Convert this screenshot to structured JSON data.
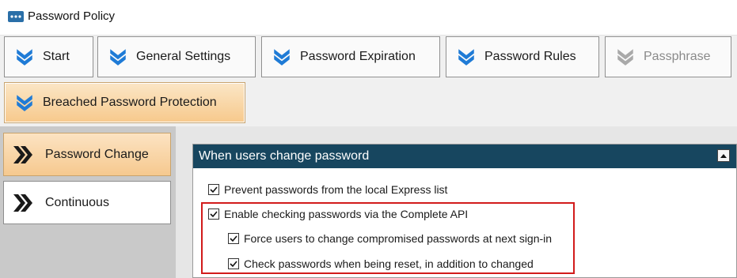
{
  "window": {
    "title": "Password Policy",
    "icon": "app-window-icon"
  },
  "toolbar": {
    "buttons": [
      {
        "label": "Start",
        "state": "normal"
      },
      {
        "label": "General Settings",
        "state": "normal"
      },
      {
        "label": "Password Expiration",
        "state": "normal"
      },
      {
        "label": "Password Rules",
        "state": "normal"
      },
      {
        "label": "Passphrase",
        "state": "disabled"
      },
      {
        "label": "Breached Password Protection",
        "state": "active"
      }
    ]
  },
  "sidebar": {
    "items": [
      {
        "label": "Password Change",
        "active": true
      },
      {
        "label": "Continuous",
        "active": false
      }
    ]
  },
  "group": {
    "title": "When users change password",
    "options": [
      {
        "label": "Prevent passwords from the local Express list",
        "checked": true
      },
      {
        "label": "Enable checking passwords via the Complete API",
        "checked": true
      },
      {
        "label": "Force users to change compromised passwords at next sign-in",
        "checked": true
      },
      {
        "label": "Check passwords when being reset, in addition to changed",
        "checked": true
      }
    ]
  },
  "colors": {
    "accent_blue": "#1f7bd6",
    "group_header": "#17465f",
    "active_orange": "#f7c98c",
    "highlight_red": "#d21b1b"
  }
}
